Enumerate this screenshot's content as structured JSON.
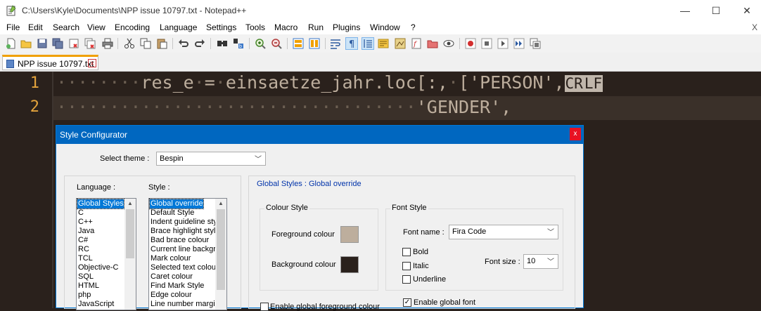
{
  "window": {
    "title": "C:\\Users\\Kyle\\Documents\\NPP issue 10797.txt - Notepad++",
    "minimize_glyph": "—",
    "maximize_glyph": "☐",
    "close_glyph": "✕"
  },
  "menu": {
    "items": [
      "File",
      "Edit",
      "Search",
      "View",
      "Encoding",
      "Language",
      "Settings",
      "Tools",
      "Macro",
      "Run",
      "Plugins",
      "Window",
      "?"
    ],
    "close_label": "X"
  },
  "toolbar": {
    "buttons": [
      "new-file-icon",
      "open-file-icon",
      "save-icon",
      "save-all-icon",
      "close-icon",
      "close-all-icon",
      "print-icon",
      "cut-icon",
      "copy-icon",
      "paste-icon",
      "undo-icon",
      "redo-icon",
      "find-icon",
      "replace-icon",
      "zoom-in-icon",
      "zoom-out-icon",
      "sync-vertical-icon",
      "sync-horizontal-icon",
      "word-wrap-icon",
      "show-all-characters-icon",
      "indent-guide-icon",
      "user-defined-language-icon",
      "document-map-icon",
      "function-list-icon",
      "folder-as-workspace-icon",
      "monitoring-icon",
      "record-macro-icon",
      "stop-record-icon",
      "play-macro-icon",
      "run-macro-multiple-icon",
      "save-macro-icon"
    ]
  },
  "tab": {
    "label": "NPP issue 10797.txt",
    "close_glyph": "x"
  },
  "editor": {
    "lines": [
      {
        "number": "1",
        "indent": "········",
        "code": "res_e = einsaetze_jahr.loc[:, ['PERSON',",
        "code_tokens": [
          "res_e",
          "·",
          "=",
          "·",
          "einsaetze_jahr.loc[:,",
          "·",
          "['PERSON',"
        ],
        "eol_markers": [
          "CR",
          "LF"
        ]
      },
      {
        "number": "2",
        "indent": "··································",
        "code": "'GENDER',"
      }
    ]
  },
  "dialog": {
    "title": "Style Configurator",
    "close_glyph": "x",
    "select_theme_label": "Select theme :",
    "theme_value": "Bespin",
    "language_label": "Language :",
    "style_label": "Style :",
    "languages": [
      "Global Styles",
      "C",
      "C++",
      "Java",
      "C#",
      "RC",
      "TCL",
      "Objective-C",
      "SQL",
      "HTML",
      "php",
      "JavaScript"
    ],
    "styles": [
      "Global override",
      "Default Style",
      "Indent guideline sty",
      "Brace highlight style",
      "Bad brace colour",
      "Current line backgr",
      "Mark colour",
      "Selected text colour",
      "Caret colour",
      "Find Mark Style",
      "Edge colour",
      "Line number margin"
    ],
    "selected_language": "Global Styles",
    "selected_style": "Global override",
    "header": "Global Styles : Global override",
    "colour_style_title": "Colour Style",
    "foreground_label": "Foreground colour",
    "background_label": "Background colour",
    "foreground_color": "#bdae9d",
    "background_color": "#2a211c",
    "font_style_title": "Font Style",
    "font_name_label": "Font name :",
    "font_name_value": "Fira Code",
    "bold_label": "Bold",
    "italic_label": "Italic",
    "underline_label": "Underline",
    "font_size_label": "Font size :",
    "font_size_value": "10",
    "enable_global_fg_label": "Enable global foreground colour",
    "enable_global_font_label": "Enable global font",
    "enable_global_fg_checked": false,
    "enable_global_font_checked": true,
    "bold_checked": false,
    "italic_checked": false,
    "underline_checked": false
  },
  "colors": {
    "editor_bg": "#2a211c",
    "text": "#bdae9d",
    "line_number": "#e3a33c",
    "whitespace": "#6c5f52",
    "current_line": "#3a3029",
    "dialog_accent": "#0067c0",
    "selection": "#0078d7"
  }
}
